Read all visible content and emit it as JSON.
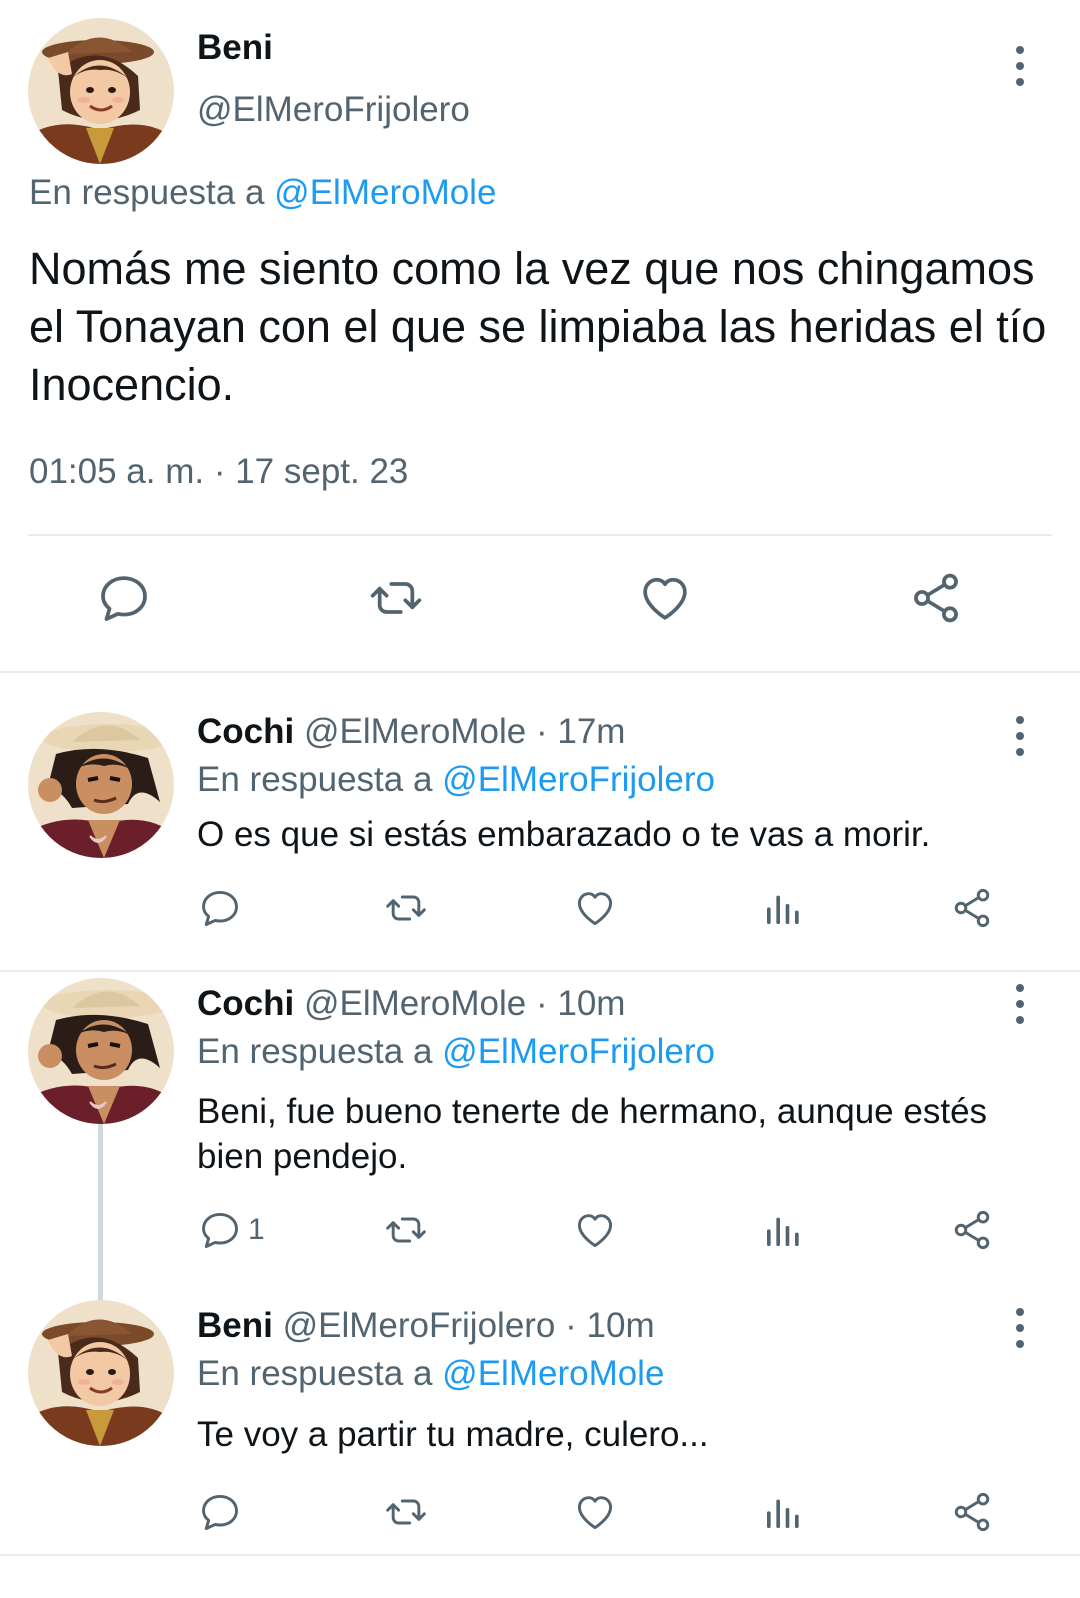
{
  "main_tweet": {
    "name": "Beni",
    "handle": "@ElMeroFrijolero",
    "replying_prefix": "En respuesta a",
    "replying_to": "@ElMeroMole",
    "text": "Nomás me siento como la vez que nos chingamos el Tonayan con el que se limpiaba las heridas el tío Inocencio.",
    "timestamp": "01:05 a. m. · 17 sept. 23",
    "avatar": "avatar-beni"
  },
  "replies": [
    {
      "name": "Cochi",
      "handle": "@ElMeroMole",
      "time": "· 17m",
      "replying_prefix": "En respuesta a",
      "replying_to": "@ElMeroFrijolero",
      "text": "O es que si estás embarazado o te vas a morir.",
      "reply_count": "",
      "avatar": "avatar-cochi"
    },
    {
      "name": "Cochi",
      "handle": "@ElMeroMole",
      "time": "· 10m",
      "replying_prefix": "En respuesta a",
      "replying_to": "@ElMeroFrijolero",
      "text": "Beni, fue bueno tenerte de hermano, aunque estés bien pendejo.",
      "reply_count": "1",
      "avatar": "avatar-cochi"
    },
    {
      "name": "Beni",
      "handle": "@ElMeroFrijolero",
      "time": "· 10m",
      "replying_prefix": "En respuesta a",
      "replying_to": "@ElMeroMole",
      "text": "Te voy a partir tu madre, culero...",
      "reply_count": "",
      "avatar": "avatar-beni"
    }
  ],
  "icons": {
    "reply": "reply-icon",
    "retweet": "retweet-icon",
    "like": "like-icon",
    "views": "views-icon",
    "share": "share-icon",
    "more": "more-icon"
  },
  "colors": {
    "text": "#0f1419",
    "secondary": "#536471",
    "link": "#1d9bf0",
    "divider": "#e6ecf0",
    "thread_line": "#cfd9de"
  }
}
